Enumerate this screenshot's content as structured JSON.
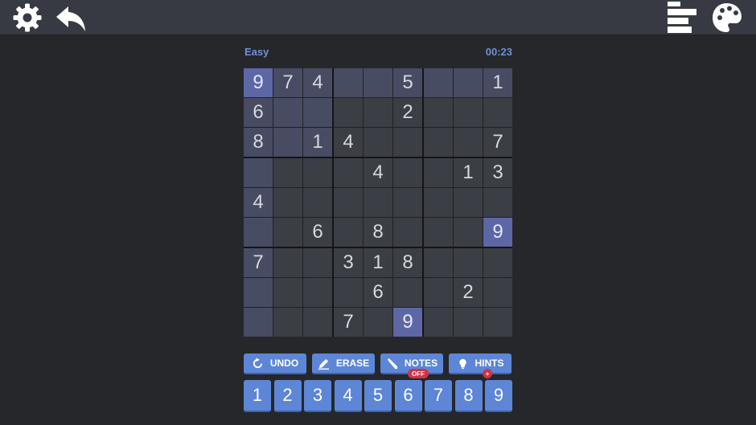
{
  "header": {
    "settings_icon": "gear-icon",
    "back_icon": "undo-arrow-icon",
    "stats_icon": "bars-icon",
    "theme_icon": "palette-icon"
  },
  "status": {
    "difficulty": "Easy",
    "timer": "00:23"
  },
  "board": {
    "rows": [
      [
        "9",
        "7",
        "4",
        "",
        "",
        "5",
        "",
        "",
        "1"
      ],
      [
        "6",
        "",
        "",
        "",
        "",
        "2",
        "",
        "",
        ""
      ],
      [
        "8",
        "",
        "1",
        "4",
        "",
        "",
        "",
        "",
        "7"
      ],
      [
        "",
        "",
        "",
        "",
        "4",
        "",
        "",
        "1",
        "3"
      ],
      [
        "4",
        "",
        "",
        "",
        "",
        "",
        "",
        "",
        ""
      ],
      [
        "",
        "",
        "6",
        "",
        "8",
        "",
        "",
        "",
        "9"
      ],
      [
        "7",
        "",
        "",
        "3",
        "1",
        "8",
        "",
        "",
        ""
      ],
      [
        "",
        "",
        "",
        "",
        "6",
        "",
        "",
        "2",
        ""
      ],
      [
        "",
        "",
        "",
        "7",
        "",
        "9",
        "",
        "",
        ""
      ]
    ],
    "selected_digit": "9",
    "selected_cell": {
      "row": 0,
      "col": 0
    },
    "colors": {
      "highlight": "#474c63",
      "selected": "#5d67a6",
      "cell": "#3c3e45"
    }
  },
  "actions": {
    "undo": "UNDO",
    "erase": "ERASE",
    "notes": "NOTES",
    "notes_state": "OFF",
    "hints": "HINTS",
    "hints_badge": "+"
  },
  "numpad": [
    "1",
    "2",
    "3",
    "4",
    "5",
    "6",
    "7",
    "8",
    "9"
  ],
  "colors": {
    "accent": "#5d86d6",
    "badge": "#cf3444",
    "label": "#6f8fd6"
  }
}
